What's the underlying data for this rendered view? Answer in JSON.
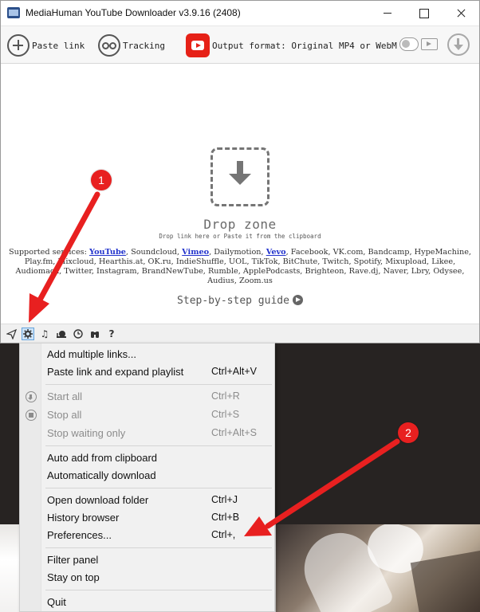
{
  "window": {
    "title": "MediaHuman YouTube Downloader v3.9.16 (2408)"
  },
  "toolbar": {
    "paste_label": "Paste link",
    "tracking_label": "Tracking",
    "output_format_label": "Output format: Original MP4 or WebM"
  },
  "drop_zone": {
    "title": "Drop zone",
    "hint": "Drop link here or Paste it from the clipboard",
    "services_prefix": "Supported services:",
    "services_link1": "YouTube",
    "services_part1": ", Soundcloud, ",
    "services_link2": "Vimeo",
    "services_part2": ", Dailymotion, ",
    "services_link3": "Vevo",
    "services_rest": ", Facebook, VK.com, Bandcamp, HypeMachine, Play.fm, Mixcloud, Hearthis.at, OK.ru, IndieShuffle, UOL, TikTok, BitChute, Twitch, Spotify, Mixupload, Likee, Audiomack, Twitter, Instagram, BrandNewTube, Rumble, ApplePodcasts, Brighteon, Rave.dj, Naver, Lbry, Odysee, Audius, Zoom.us",
    "guide": "Step-by-step guide"
  },
  "statusbar": {
    "icons": [
      "send-icon",
      "gear-icon",
      "music-note-icon",
      "snail-icon",
      "clock-icon",
      "binoculars-icon",
      "help-icon"
    ],
    "help_glyph": "?"
  },
  "menu": {
    "items": [
      {
        "label": "Add multiple links...",
        "shortcut": ""
      },
      {
        "label": "Paste link and expand playlist",
        "shortcut": "Ctrl+Alt+V"
      },
      {
        "label": "Start all",
        "shortcut": "Ctrl+R"
      },
      {
        "label": "Stop all",
        "shortcut": "Ctrl+S"
      },
      {
        "label": "Stop waiting only",
        "shortcut": "Ctrl+Alt+S"
      },
      {
        "label": "Auto add from clipboard",
        "shortcut": ""
      },
      {
        "label": "Automatically download",
        "shortcut": ""
      },
      {
        "label": "Open download folder",
        "shortcut": "Ctrl+J"
      },
      {
        "label": "History browser",
        "shortcut": "Ctrl+B"
      },
      {
        "label": "Preferences...",
        "shortcut": "Ctrl+,"
      },
      {
        "label": "Filter panel",
        "shortcut": ""
      },
      {
        "label": "Stay on top",
        "shortcut": ""
      },
      {
        "label": "Quit",
        "shortcut": ""
      }
    ]
  },
  "annotations": {
    "badge1": "1",
    "badge2": "2",
    "arrow_color": "#e82020"
  }
}
